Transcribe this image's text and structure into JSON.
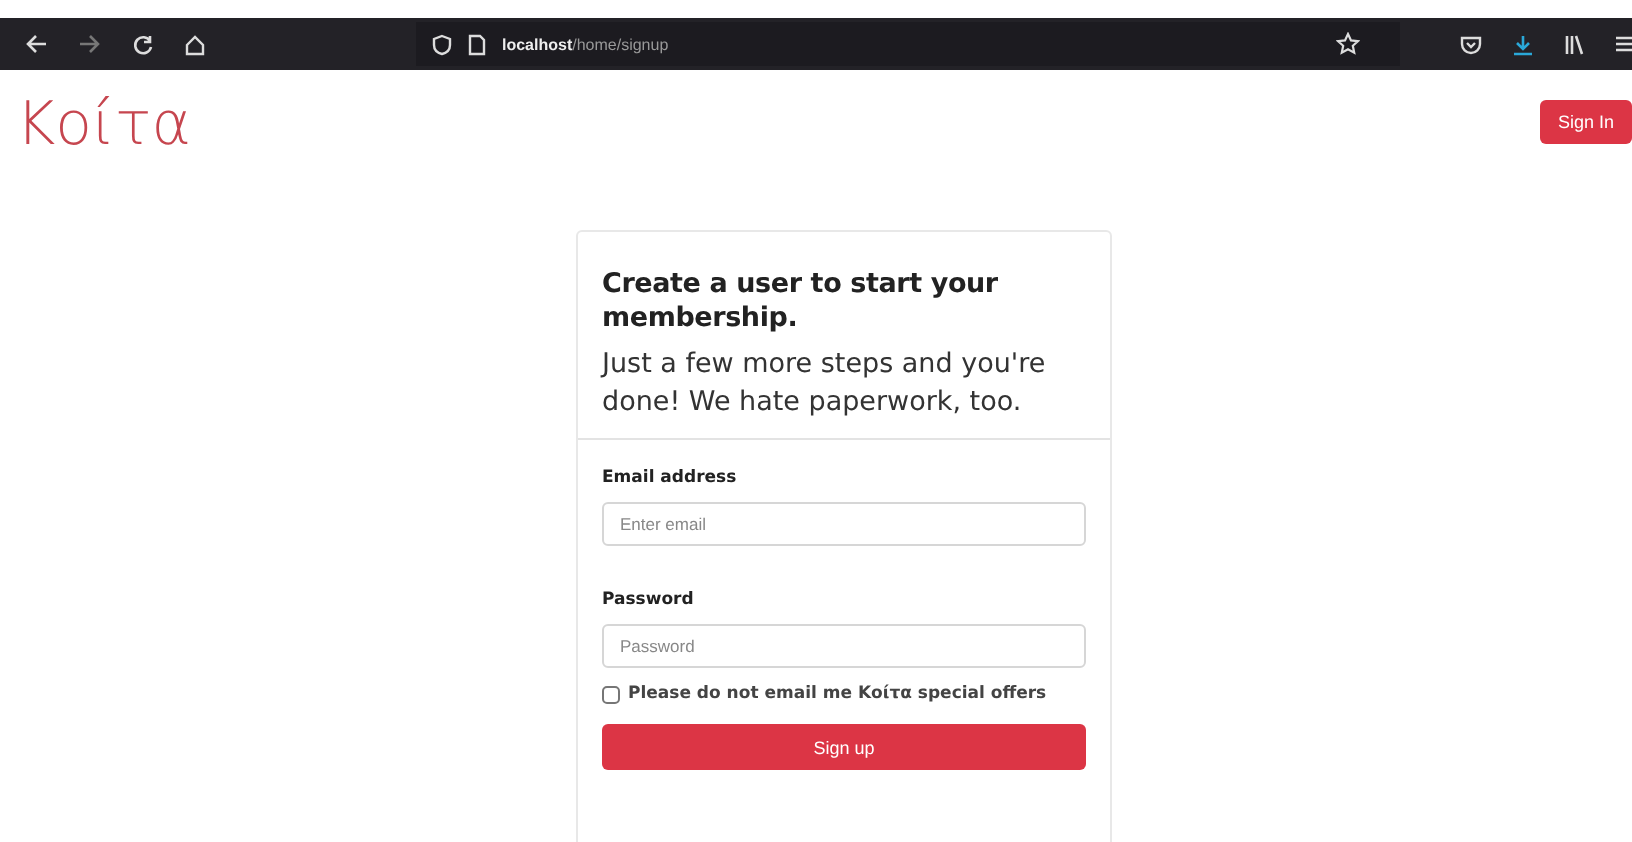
{
  "browser": {
    "url_host": "localhost",
    "url_path": "/home/signup"
  },
  "header": {
    "logo": "Κοίτα",
    "sign_in": "Sign In"
  },
  "card": {
    "title": "Create a user to start your membership.",
    "subtitle": "Just a few more steps and you're done! We hate paperwork, too.",
    "fields": [
      {
        "label": "Email address",
        "placeholder": "Enter email"
      },
      {
        "label": "Password",
        "placeholder": "Password"
      }
    ],
    "opt_out": {
      "label": "Please do not email me Κοίτα special offers",
      "checked": false
    },
    "submit": "Sign up"
  }
}
